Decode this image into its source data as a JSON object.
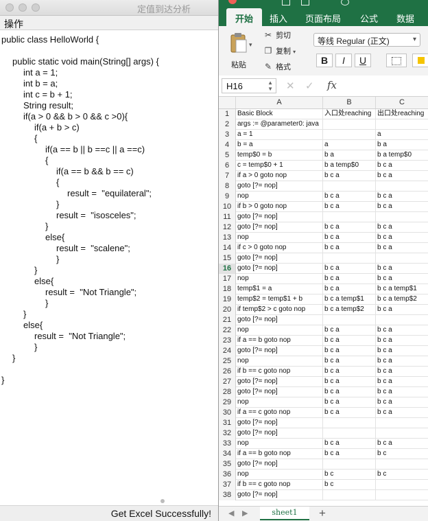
{
  "left_window": {
    "title": "定值到达分析",
    "menu": "操作",
    "status": "Get Excel Successfully!",
    "code_lines": [
      {
        "text": "public class HelloWorld {",
        "indent": 0
      },
      {
        "text": "",
        "indent": 0
      },
      {
        "text": "public static void main(String[] args) {",
        "indent": 1
      },
      {
        "text": "int a = 1;",
        "indent": 2
      },
      {
        "text": "int b = a;",
        "indent": 2
      },
      {
        "text": "int c = b + 1;",
        "indent": 2
      },
      {
        "text": "String result;",
        "indent": 2
      },
      {
        "text": "if(a > 0 && b > 0 && c >0){",
        "indent": 2
      },
      {
        "text": "if(a + b > c)",
        "indent": 3
      },
      {
        "text": "{",
        "indent": 3
      },
      {
        "text": "if(a == b || b ==c || a ==c)",
        "indent": 4
      },
      {
        "text": "{",
        "indent": 4
      },
      {
        "text": "if(a == b && b == c)",
        "indent": 5
      },
      {
        "text": "{",
        "indent": 5
      },
      {
        "text": "result =  \"equilateral\";",
        "indent": 6
      },
      {
        "text": "}",
        "indent": 5
      },
      {
        "text": "result =  \"isosceles\";",
        "indent": 5
      },
      {
        "text": "}",
        "indent": 4
      },
      {
        "text": "else{",
        "indent": 4
      },
      {
        "text": "result =  \"scalene\";",
        "indent": 5
      },
      {
        "text": "}",
        "indent": 5
      },
      {
        "text": "}",
        "indent": 3
      },
      {
        "text": "else{",
        "indent": 3
      },
      {
        "text": "result =  \"Not Triangle\";",
        "indent": 4
      },
      {
        "text": "}",
        "indent": 4
      },
      {
        "text": "}",
        "indent": 2
      },
      {
        "text": "else{",
        "indent": 2
      },
      {
        "text": "result =  \"Not Triangle\";",
        "indent": 3
      },
      {
        "text": "}",
        "indent": 3
      },
      {
        "text": "}",
        "indent": 1
      },
      {
        "text": "",
        "indent": 0
      },
      {
        "text": "}",
        "indent": 0
      }
    ]
  },
  "excel": {
    "tabs": [
      "开始",
      "插入",
      "页面布局",
      "公式",
      "数据"
    ],
    "paste_label": "粘贴",
    "clipboard": {
      "cut": "剪切",
      "copy": "复制",
      "format": "格式"
    },
    "font_name": "等线 Regular (正文)",
    "format_buttons": [
      "B",
      "I",
      "U"
    ],
    "name_box": "H16",
    "fx": "fx",
    "columns": [
      "A",
      "B",
      "C"
    ],
    "selected_row": "16",
    "rows": [
      {
        "n": "1",
        "a": "Basic Block",
        "b": "入口处reaching",
        "c": "出口处reaching"
      },
      {
        "n": "2",
        "a": "args := @parameter0: java",
        "b": "",
        "c": ""
      },
      {
        "n": "3",
        "a": "a = 1",
        "b": "",
        "c": "a"
      },
      {
        "n": "4",
        "a": "b = a",
        "b": "a",
        "c": "b a"
      },
      {
        "n": "5",
        "a": "temp$0 = b",
        "b": "b a",
        "c": "b a temp$0"
      },
      {
        "n": "6",
        "a": "c = temp$0 + 1",
        "b": "b a temp$0",
        "c": "b c a"
      },
      {
        "n": "7",
        "a": "if a > 0 goto nop",
        "b": "b c a",
        "c": "b c a"
      },
      {
        "n": "8",
        "a": "goto [?= nop]",
        "b": "",
        "c": ""
      },
      {
        "n": "9",
        "a": "nop",
        "b": "b c a",
        "c": "b c a"
      },
      {
        "n": "10",
        "a": "if b > 0 goto nop",
        "b": "b c a",
        "c": "b c a"
      },
      {
        "n": "11",
        "a": "goto [?= nop]",
        "b": "",
        "c": ""
      },
      {
        "n": "12",
        "a": "goto [?= nop]",
        "b": "b c a",
        "c": "b c a"
      },
      {
        "n": "13",
        "a": "nop",
        "b": "b c a",
        "c": "b c a"
      },
      {
        "n": "14",
        "a": "if c > 0 goto nop",
        "b": "b c a",
        "c": "b c a"
      },
      {
        "n": "15",
        "a": "goto [?= nop]",
        "b": "",
        "c": ""
      },
      {
        "n": "16",
        "a": "goto [?= nop]",
        "b": "b c a",
        "c": "b c a"
      },
      {
        "n": "17",
        "a": "nop",
        "b": "b c a",
        "c": "b c a"
      },
      {
        "n": "18",
        "a": "temp$1 = a",
        "b": "b c a",
        "c": "b c a temp$1"
      },
      {
        "n": "19",
        "a": "temp$2 = temp$1 + b",
        "b": "b c a temp$1",
        "c": "b c a temp$2"
      },
      {
        "n": "20",
        "a": "if temp$2 > c goto nop",
        "b": "b c a temp$2",
        "c": "b c a"
      },
      {
        "n": "21",
        "a": "goto [?= nop]",
        "b": "",
        "c": ""
      },
      {
        "n": "22",
        "a": "nop",
        "b": "b c a",
        "c": "b c a"
      },
      {
        "n": "23",
        "a": "if a == b goto nop",
        "b": "b c a",
        "c": "b c a"
      },
      {
        "n": "24",
        "a": "goto [?= nop]",
        "b": "b c a",
        "c": "b c a"
      },
      {
        "n": "25",
        "a": "nop",
        "b": "b c a",
        "c": "b c a"
      },
      {
        "n": "26",
        "a": "if b == c goto nop",
        "b": "b c a",
        "c": "b c a"
      },
      {
        "n": "27",
        "a": "goto [?= nop]",
        "b": "b c a",
        "c": "b c a"
      },
      {
        "n": "28",
        "a": "goto [?= nop]",
        "b": "b c a",
        "c": "b c a"
      },
      {
        "n": "29",
        "a": "nop",
        "b": "b c a",
        "c": "b c a"
      },
      {
        "n": "30",
        "a": "if a == c goto nop",
        "b": "b c a",
        "c": "b c a"
      },
      {
        "n": "31",
        "a": "goto [?= nop]",
        "b": "",
        "c": ""
      },
      {
        "n": "32",
        "a": "goto [?= nop]",
        "b": "",
        "c": ""
      },
      {
        "n": "33",
        "a": "nop",
        "b": "b c a",
        "c": "b c a"
      },
      {
        "n": "34",
        "a": "if a == b goto nop",
        "b": "b c a",
        "c": "b c"
      },
      {
        "n": "35",
        "a": "goto [?= nop]",
        "b": "",
        "c": ""
      },
      {
        "n": "36",
        "a": "nop",
        "b": "b c",
        "c": "b c"
      },
      {
        "n": "37",
        "a": "if b == c goto nop",
        "b": "b c",
        "c": ""
      },
      {
        "n": "38",
        "a": "goto [?= nop]",
        "b": "",
        "c": ""
      }
    ],
    "sheet_name": "sheet1",
    "add_sheet": "+"
  }
}
